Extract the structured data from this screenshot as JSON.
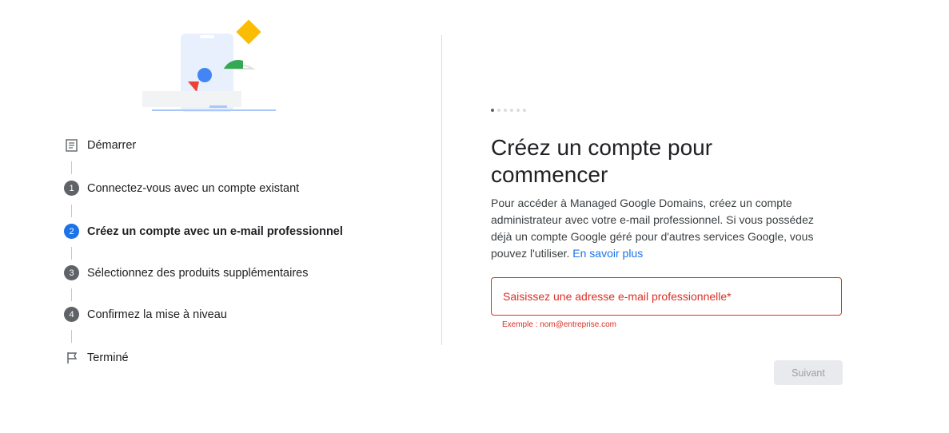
{
  "progress": {
    "total_dots": 6,
    "current_dot": 1
  },
  "steps": [
    {
      "icon": "document-icon",
      "label": "Démarrer"
    },
    {
      "number": "1",
      "label": "Connectez-vous avec un compte existant"
    },
    {
      "number": "2",
      "label": "Créez un compte avec un e-mail professionnel",
      "active": true
    },
    {
      "number": "3",
      "label": "Sélectionnez des produits supplémentaires"
    },
    {
      "number": "4",
      "label": "Confirmez la mise à niveau"
    },
    {
      "icon": "flag-icon",
      "label": "Terminé"
    }
  ],
  "main": {
    "title": "Créez un compte pour commencer",
    "description": "Pour accéder à Managed Google Domains, créez un compte administrateur avec votre e-mail professionnel. Si vous possédez déjà un compte Google géré pour d'autres services Google, vous pouvez l'utiliser.",
    "learn_more": "En savoir plus",
    "email_placeholder": "Saisissez une adresse e-mail professionnelle*",
    "email_value": "",
    "hint": "Exemple : nom@entreprise.com",
    "next_button": "Suivant"
  },
  "colors": {
    "accent": "#1a73e8",
    "error": "#d93025",
    "step_badge": "#5f6368",
    "button_disabled_bg": "#e8eaed"
  }
}
